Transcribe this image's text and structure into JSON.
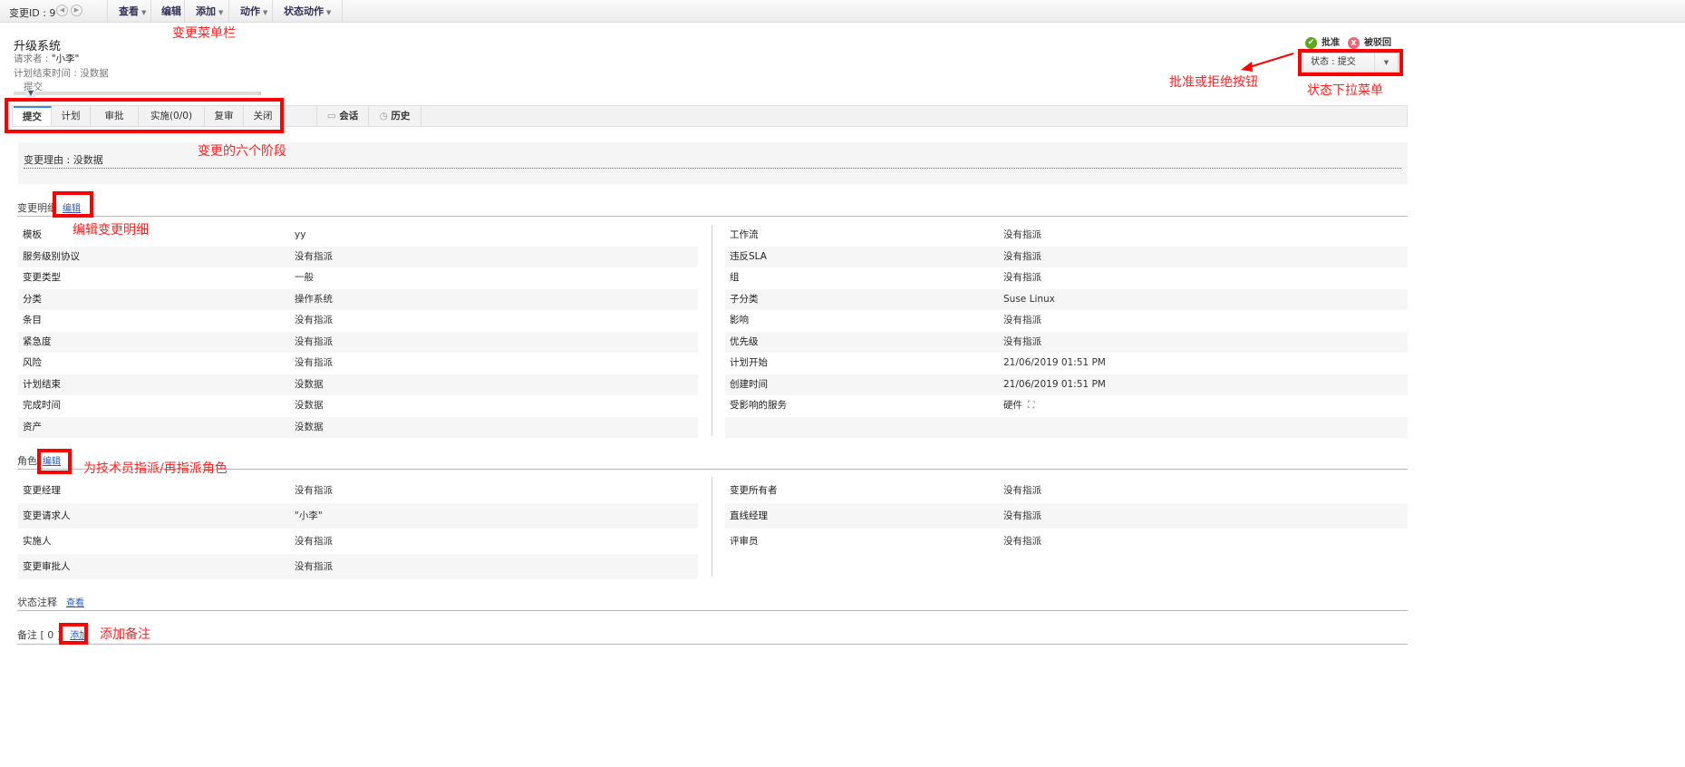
{
  "toolbar": {
    "change_id": "变更ID : 9",
    "menus": [
      "查看",
      "编辑",
      "添加",
      "动作",
      "状态动作"
    ]
  },
  "header": {
    "title": "升级系统",
    "requester_label": "请求者 : ",
    "requester": "\"小李\"",
    "plan_end": "计划结束时间 : 没数据",
    "stage": "提交"
  },
  "actions": {
    "approve": "批准",
    "reject": "被驳回",
    "status": "状态 : 提交"
  },
  "tabs": [
    "提交",
    "计划",
    "审批",
    "实施(0/0)",
    "复审",
    "关闭"
  ],
  "extra_tabs": [
    "会话",
    "历史"
  ],
  "reason": "变更理由 : 没数据",
  "details": {
    "title": "变更明细",
    "edit": "编辑",
    "left": [
      [
        "模板",
        "yy"
      ],
      [
        "服务级别协议",
        "没有指派"
      ],
      [
        "变更类型",
        "一般"
      ],
      [
        "分类",
        "操作系统"
      ],
      [
        "条目",
        "没有指派"
      ],
      [
        "紧急度",
        "没有指派"
      ],
      [
        "风险",
        "没有指派"
      ],
      [
        "计划结束",
        "没数据"
      ],
      [
        "完成时间",
        "没数据"
      ],
      [
        "资产",
        "没数据"
      ]
    ],
    "right": [
      [
        "工作流",
        "没有指派"
      ],
      [
        "违反SLA",
        "没有指派"
      ],
      [
        "组",
        "没有指派"
      ],
      [
        "子分类",
        "Suse Linux"
      ],
      [
        "影响",
        "没有指派"
      ],
      [
        "优先级",
        "没有指派"
      ],
      [
        "计划开始",
        "21/06/2019 01:51 PM"
      ],
      [
        "创建时间",
        "21/06/2019 01:51 PM"
      ],
      [
        "受影响的服务",
        "硬件"
      ],
      [
        "",
        ""
      ]
    ]
  },
  "roles": {
    "title": "角色",
    "edit": "编辑",
    "left": [
      [
        "变更经理",
        "没有指派"
      ],
      [
        "变更请求人",
        "\"小李\""
      ],
      [
        "实施人",
        "没有指派"
      ],
      [
        "变更审批人",
        "没有指派"
      ]
    ],
    "right": [
      [
        "变更所有者",
        "没有指派"
      ],
      [
        "直线经理",
        "没有指派"
      ],
      [
        "评审员",
        "没有指派"
      ]
    ]
  },
  "status_notes": {
    "title": "状态注释",
    "view": "查看"
  },
  "notes": {
    "title": "备注 [ 0 ]",
    "add": "添加"
  },
  "annotations": {
    "menubar": "变更菜单栏",
    "approve_reject": "批准或拒绝按钮",
    "status_dropdown": "状态下拉菜单",
    "stages": "变更的六个阶段",
    "edit_details": "编辑变更明细",
    "assign_roles": "为技术员指派/再指派角色",
    "add_note": "添加备注"
  }
}
